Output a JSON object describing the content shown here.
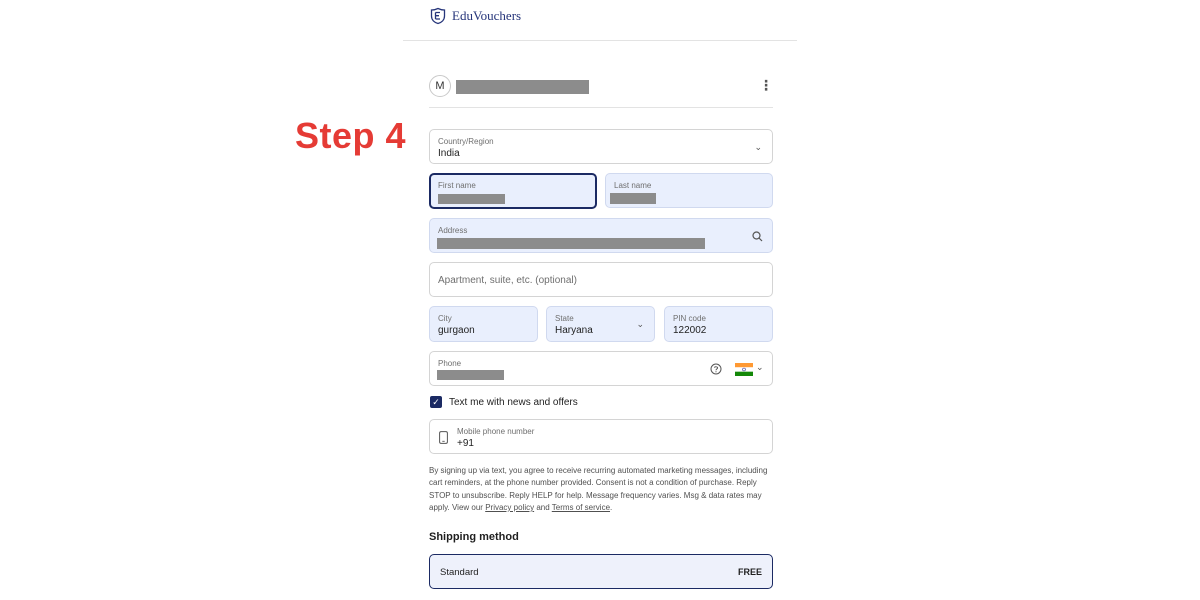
{
  "brand": {
    "name": "EduVouchers",
    "logo_icon": "shield-E-icon"
  },
  "step_label": "Step 4",
  "account": {
    "avatar_initial": "M",
    "menu_icon": "kebab-menu-icon"
  },
  "form": {
    "country": {
      "label": "Country/Region",
      "value": "India"
    },
    "first_name": {
      "label": "First name"
    },
    "last_name": {
      "label": "Last name"
    },
    "address": {
      "label": "Address",
      "icon": "search-icon"
    },
    "apartment": {
      "placeholder": "Apartment, suite, etc. (optional)"
    },
    "city": {
      "label": "City",
      "value": "gurgaon"
    },
    "state": {
      "label": "State",
      "value": "Haryana"
    },
    "pin": {
      "label": "PIN code",
      "value": "122002"
    },
    "phone": {
      "label": "Phone",
      "help_icon": "question-circle-icon",
      "flag_icon": "india-flag-icon"
    },
    "sms_opt_in": {
      "label": "Text me with news and offers",
      "checked": true
    },
    "mobile": {
      "label": "Mobile phone number",
      "value": "+91",
      "icon": "mobile-phone-icon"
    }
  },
  "legal": {
    "text": "By signing up via text, you agree to receive recurring automated marketing messages, including cart reminders, at the phone number provided. Consent is not a condition of purchase. Reply STOP to unsubscribe. Reply HELP for help. Message frequency varies. Msg & data rates may apply. View our",
    "privacy_link": "Privacy policy",
    "and": "and",
    "terms_link": "Terms of service",
    "end": "."
  },
  "shipping": {
    "title": "Shipping method",
    "option_name": "Standard",
    "option_price": "FREE"
  },
  "colors": {
    "accent": "#1b2a63",
    "step": "#e53b35",
    "filled_field": "#e9effd",
    "redaction": "#8c8c8c"
  }
}
